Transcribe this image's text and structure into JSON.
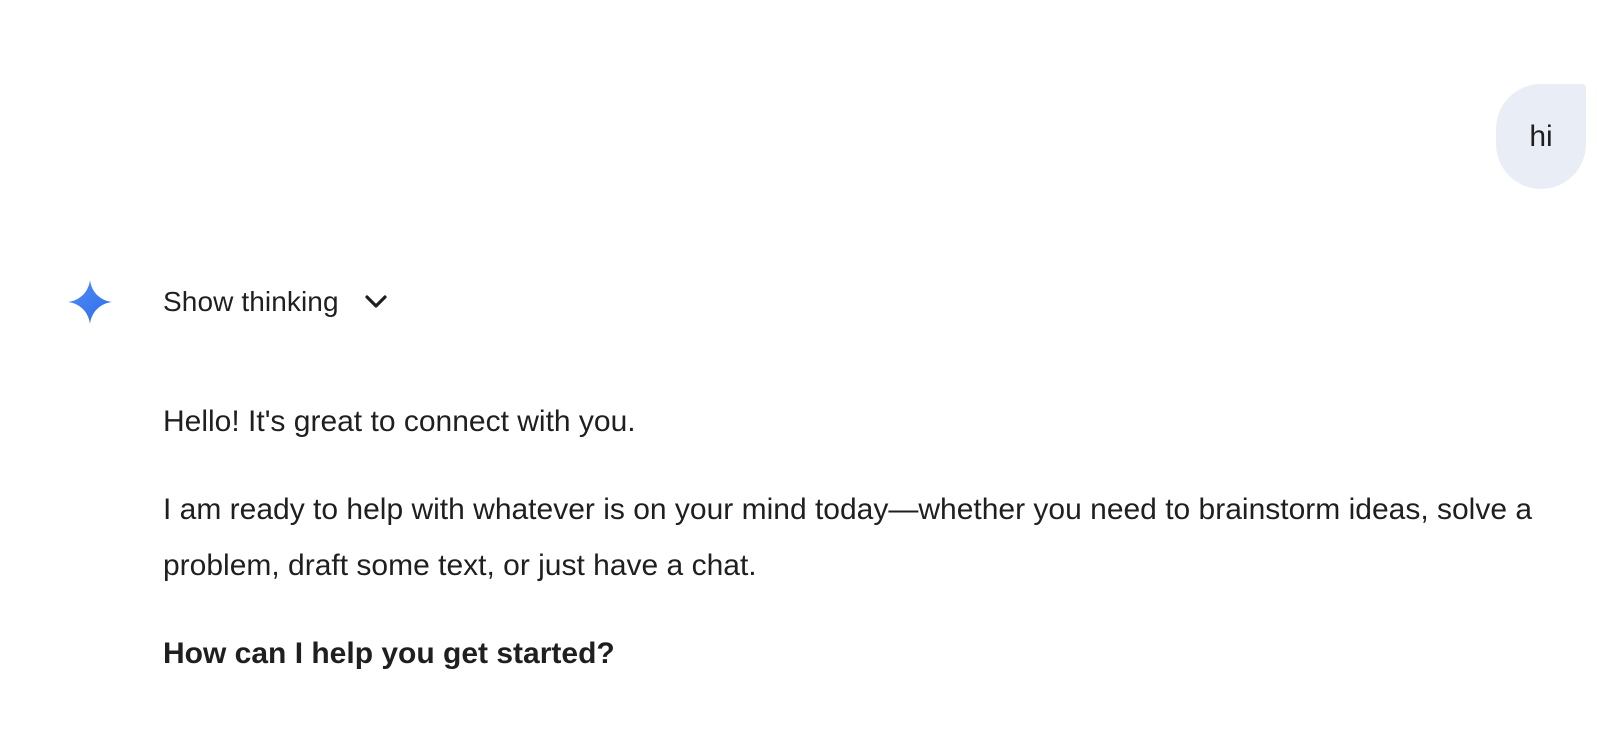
{
  "user_message": {
    "text": "hi"
  },
  "assistant": {
    "icon": "gemini-sparkle-icon",
    "accent_color": "#4285f4",
    "thinking_toggle_label": "Show thinking",
    "paragraphs": [
      "Hello! It's great to connect with you.",
      "I am ready to help with whatever is on your mind today—whether you need to brainstorm ideas, solve a problem, draft some text, or just have a chat.",
      "How can I help you get started?"
    ]
  }
}
